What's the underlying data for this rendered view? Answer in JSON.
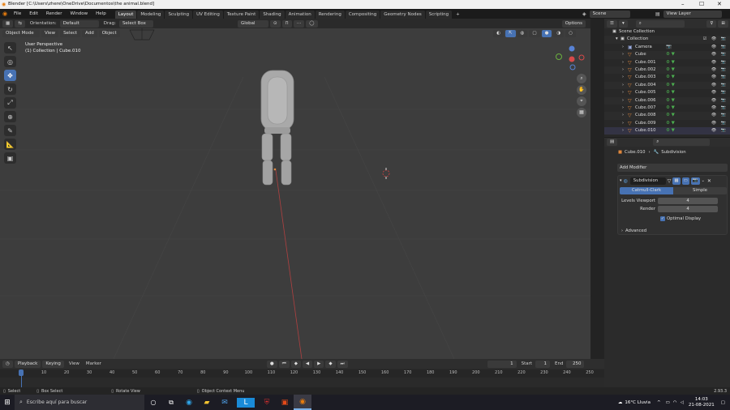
{
  "titlebar": {
    "title": "Blender [C:\\Users\\zhere\\OneDrive\\Documentos\\the animal.blend]"
  },
  "menus": [
    "File",
    "Edit",
    "Render",
    "Window",
    "Help"
  ],
  "workspaces": [
    "Layout",
    "Modeling",
    "Sculpting",
    "UV Editing",
    "Texture Paint",
    "Shading",
    "Animation",
    "Rendering",
    "Compositing",
    "Geometry Nodes",
    "Scripting"
  ],
  "scene": {
    "scene_label": "Scene",
    "view_layer_label": "View Layer"
  },
  "viewport_header": {
    "orientation_label": "Orientation:",
    "orientation_value": "Default",
    "drag_label": "Drag:",
    "drag_value": "Select Box",
    "transform_value": "Global",
    "options_label": "Options"
  },
  "viewport_header2": {
    "mode": "Object Mode",
    "menus": [
      "View",
      "Select",
      "Add",
      "Object"
    ]
  },
  "viewport_info": {
    "line1": "User Perspective",
    "line2": "(1) Collection | Cube.010"
  },
  "outliner": {
    "scene_collection": "Scene Collection",
    "collection": "Collection",
    "items": [
      "Camera",
      "Cube",
      "Cube.001",
      "Cube.002",
      "Cube.003",
      "Cube.004",
      "Cube.005",
      "Cube.006",
      "Cube.007",
      "Cube.008",
      "Cube.009",
      "Cube.010"
    ]
  },
  "properties": {
    "object_name": "Cube.010",
    "modifier_breadcrumb": "Subdivision",
    "add_modifier": "Add Modifier",
    "modifier_name": "Subdivision",
    "mode_catmull": "Catmull-Clark",
    "mode_simple": "Simple",
    "levels_viewport_label": "Levels Viewport",
    "levels_viewport_value": "4",
    "render_label": "Render",
    "render_value": "4",
    "optimal_display": "Optimal Display",
    "advanced": "Advanced"
  },
  "timeline": {
    "playback": "Playback",
    "keying": "Keying",
    "view": "View",
    "marker": "Marker",
    "current_frame": "1",
    "start_label": "Start",
    "start_value": "1",
    "end_label": "End",
    "end_value": "250",
    "ticks": [
      "0",
      "10",
      "20",
      "30",
      "40",
      "50",
      "60",
      "70",
      "80",
      "90",
      "100",
      "110",
      "120",
      "130",
      "140",
      "150",
      "160",
      "170",
      "180",
      "190",
      "200",
      "210",
      "220",
      "230",
      "240",
      "250"
    ]
  },
  "statusbar": {
    "select": "Select",
    "box_select": "Box Select",
    "rotate_view": "Rotate View",
    "context_menu": "Object Context Menu",
    "version": "2.93.3"
  },
  "taskbar": {
    "search_placeholder": "Escribe aquí para buscar",
    "weather": "16°C  Lluvia",
    "time": "14:03",
    "date": "21-08-2021"
  },
  "colors": {
    "accent": "#4772b3",
    "orange": "#e0883d",
    "viewport_bg": "#3d3d3d"
  }
}
